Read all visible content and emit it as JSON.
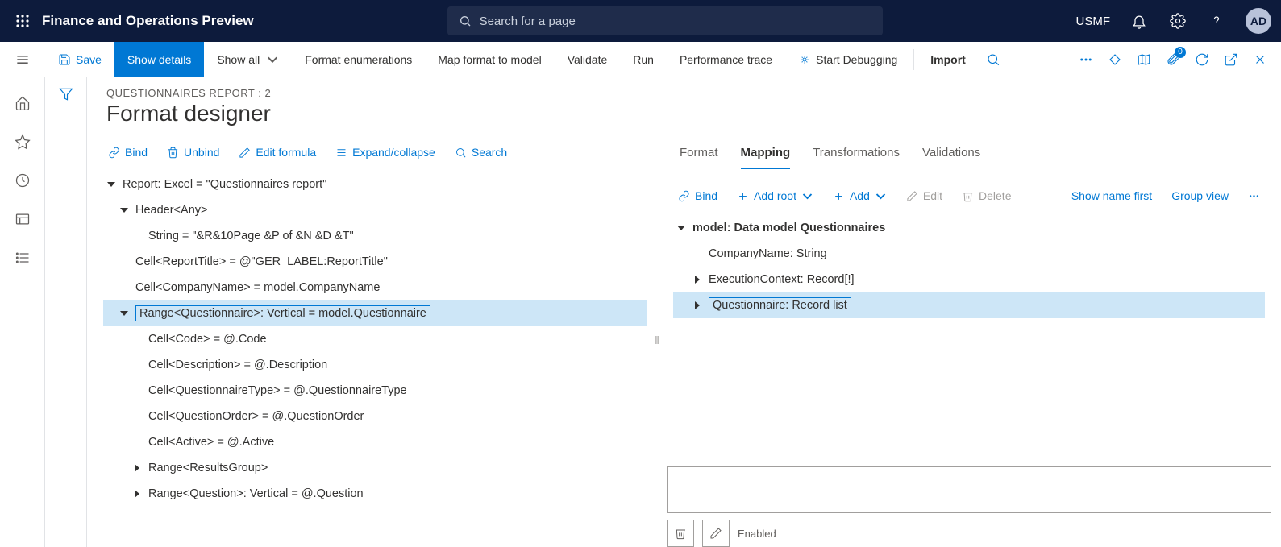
{
  "topNav": {
    "appTitle": "Finance and Operations Preview",
    "searchPlaceholder": "Search for a page",
    "companyCode": "USMF",
    "avatarInitials": "AD"
  },
  "commandBar": {
    "save": "Save",
    "showDetails": "Show details",
    "showAll": "Show all",
    "formatEnumerations": "Format enumerations",
    "mapFormatToModel": "Map format to model",
    "validate": "Validate",
    "run": "Run",
    "performanceTrace": "Performance trace",
    "startDebugging": "Start Debugging",
    "import": "Import",
    "badgeCount": "0"
  },
  "header": {
    "breadcrumb": "QUESTIONNAIRES REPORT : 2",
    "title": "Format designer"
  },
  "leftToolbar": {
    "bind": "Bind",
    "unbind": "Unbind",
    "editFormula": "Edit formula",
    "expandCollapse": "Expand/collapse",
    "search": "Search"
  },
  "formatTree": {
    "root": "Report: Excel = \"Questionnaires report\"",
    "header": "Header<Any>",
    "headerString": "String = \"&R&10Page &P of &N &D &T\"",
    "cellReportTitle": "Cell<ReportTitle> = @\"GER_LABEL:ReportTitle\"",
    "cellCompanyName": "Cell<CompanyName> = model.CompanyName",
    "rangeQuestionnaire": "Range<Questionnaire>: Vertical = model.Questionnaire",
    "cellCode": "Cell<Code> = @.Code",
    "cellDescription": "Cell<Description> = @.Description",
    "cellQuestionnaireType": "Cell<QuestionnaireType> = @.QuestionnaireType",
    "cellQuestionOrder": "Cell<QuestionOrder> = @.QuestionOrder",
    "cellActive": "Cell<Active> = @.Active",
    "rangeResultsGroup": "Range<ResultsGroup>",
    "rangeQuestion": "Range<Question>: Vertical = @.Question"
  },
  "rightTabs": {
    "format": "Format",
    "mapping": "Mapping",
    "transformations": "Transformations",
    "validations": "Validations"
  },
  "rightToolbar": {
    "bind": "Bind",
    "addRoot": "Add root",
    "add": "Add",
    "edit": "Edit",
    "delete": "Delete",
    "showNameFirst": "Show name first",
    "groupView": "Group view"
  },
  "modelTree": {
    "root": "model: Data model Questionnaires",
    "companyName": "CompanyName: String",
    "executionContext": "ExecutionContext: Record[!]",
    "questionnaire": "Questionnaire: Record list"
  },
  "bottom": {
    "enabledLabel": "Enabled"
  }
}
